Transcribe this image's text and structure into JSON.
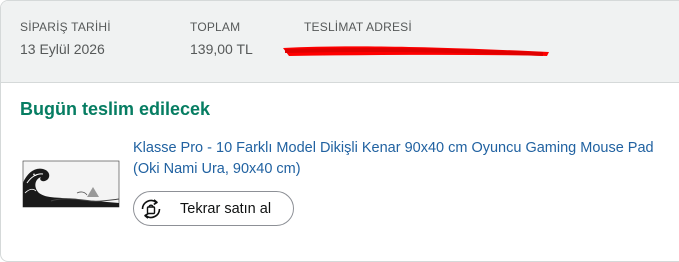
{
  "order": {
    "date_label": "SİPARİŞ TARİHİ",
    "date_value": "13 Eylül 2026",
    "total_label": "TOPLAM",
    "total_value": "139,00 TL",
    "address_label": "TESLİMAT ADRESİ"
  },
  "delivery": {
    "status": "Bugün teslim edilecek"
  },
  "product": {
    "title": "Klasse Pro - 10 Farklı Model Dikişli Kenar 90x40 cm Oyuncu Gaming Mouse Pad (Oki Nami Ura, 90x40 cm)",
    "image_icon": "wave-mousepad-image"
  },
  "actions": {
    "rebuy_label": "Tekrar satın al",
    "rebuy_icon": "rebuy-icon"
  },
  "colors": {
    "delivery_green": "#067d62",
    "link_blue": "#2162a1",
    "header_bg": "#f0f2f2",
    "redaction_red": "#ff0000"
  }
}
